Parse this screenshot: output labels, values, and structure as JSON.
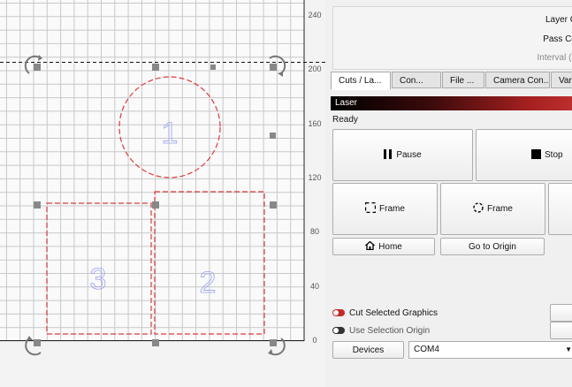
{
  "canvas": {
    "y_axis_labels": [
      "240",
      "200",
      "160",
      "120",
      "80",
      "40",
      "0"
    ],
    "shape_labels": {
      "circle": "1",
      "left_rect": "3",
      "right_rect": "2"
    },
    "colors": {
      "cut_line": "#e03a3a",
      "grid": "#c8c8c8",
      "number": "#9aa0ee",
      "handle": "#888888"
    }
  },
  "info": {
    "layer_label": "Layer C",
    "pass_label": "Pass Co",
    "interval_label": "Interval (n"
  },
  "tabs": [
    "Cuts / La...",
    "Con...",
    "File ...",
    "Camera Con...",
    "Vari"
  ],
  "laser": {
    "header": "Laser",
    "status": "Ready",
    "pause_label": "Pause",
    "stop_label": "Stop",
    "frame_rect_label": "Frame",
    "frame_circle_label": "Frame",
    "home_label": "Home",
    "origin_label": "Go to Origin",
    "cut_selected_label": "Cut Selected Graphics",
    "use_selection_label": "Use Selection Origin",
    "devices_label": "Devices",
    "port_value": "COM4"
  },
  "icons": {
    "pause": "pause-icon",
    "stop": "stop-icon",
    "frame_rect": "frame-rect-icon",
    "frame_circle": "frame-circle-icon",
    "home": "home-icon",
    "dropdown": "chevron-down-icon"
  },
  "toggles": {
    "cut_selected": true,
    "use_selection": false
  },
  "accent": "#c62828"
}
